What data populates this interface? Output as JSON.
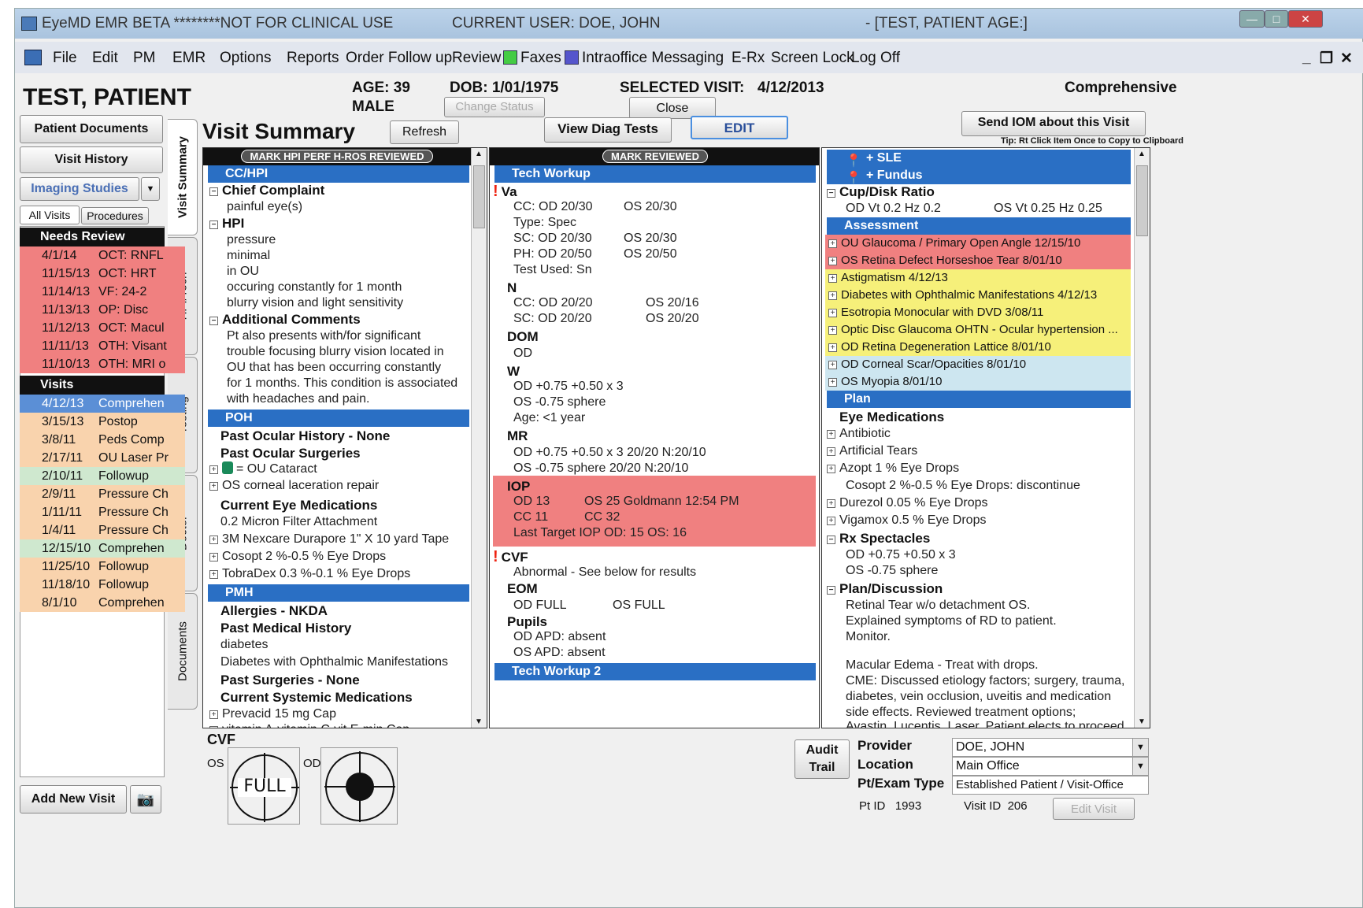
{
  "titlebar": {
    "app": "EyeMD EMR BETA ********NOT FOR CLINICAL USE",
    "user": "CURRENT USER: DOE, JOHN",
    "patient": "- [TEST, PATIENT  AGE:]"
  },
  "menu": [
    "File",
    "Edit",
    "PM",
    "EMR",
    "Options",
    "Reports",
    "Order Follow up",
    "Review",
    "Faxes",
    "Intraoffice Messaging",
    "E-Rx",
    "Screen Lock",
    "Log Off"
  ],
  "patient": {
    "name": "TEST, PATIENT",
    "age": "AGE: 39",
    "sex": "MALE",
    "dob": "DOB: 1/01/1975",
    "selected_visit_label": "SELECTED VISIT:",
    "selected_visit": "4/12/2013",
    "visit_type": "Comprehensive"
  },
  "buttons": {
    "change_status": "Change Status",
    "close": "Close",
    "patient_documents": "Patient Documents",
    "visit_history": "Visit History",
    "imaging_studies": "Imaging Studies",
    "all_visits": "All Visits",
    "procedures": "Procedures",
    "refresh": "Refresh",
    "view_diag_tests": "View Diag Tests",
    "edit": "EDIT",
    "send_iom": "Send IOM about this Visit",
    "tip": "Tip: Rt Click Item Once to Copy to Clipboard",
    "add_new_visit": "Add New Visit",
    "audit_trail": "Audit Trail",
    "edit_visit": "Edit Visit"
  },
  "page_title": "Visit Summary",
  "vertical_tabs": [
    "Visit Summary",
    "HPI/Tech",
    "Testing",
    "Doctor",
    "Documents"
  ],
  "needs_review": {
    "header": "Needs Review",
    "items": [
      {
        "date": "4/1/14",
        "desc": "OCT: RNFL"
      },
      {
        "date": "11/15/13",
        "desc": "OCT: HRT"
      },
      {
        "date": "11/14/13",
        "desc": "VF: 24-2"
      },
      {
        "date": "11/13/13",
        "desc": "OP: Disc"
      },
      {
        "date": "11/12/13",
        "desc": "OCT: Macul"
      },
      {
        "date": "11/11/13",
        "desc": "OTH: Visant"
      },
      {
        "date": "11/10/13",
        "desc": "OTH: MRI o"
      }
    ]
  },
  "visits": {
    "header": "Visits",
    "items": [
      {
        "date": "4/12/13",
        "desc": "Comprehen"
      },
      {
        "date": "3/15/13",
        "desc": "Postop"
      },
      {
        "date": "3/8/11",
        "desc": "Peds Comp"
      },
      {
        "date": "2/17/11",
        "desc": "OU Laser Pr"
      },
      {
        "date": "2/10/11",
        "desc": "Followup"
      },
      {
        "date": "2/9/11",
        "desc": "Pressure Ch"
      },
      {
        "date": "1/11/11",
        "desc": "Pressure Ch"
      },
      {
        "date": "1/4/11",
        "desc": "Pressure Ch"
      },
      {
        "date": "12/15/10",
        "desc": "Comprehen"
      },
      {
        "date": "11/25/10",
        "desc": "Followup"
      },
      {
        "date": "11/18/10",
        "desc": "Followup"
      },
      {
        "date": "8/1/10",
        "desc": "Comprehen"
      }
    ]
  },
  "col1": {
    "mark": "MARK HPI PERF H-ROS REVIEWED",
    "sections": {
      "cchpi": "CC/HPI",
      "poh": "POH",
      "pmh": "PMH"
    },
    "lines": [
      "Chief Complaint",
      "painful eye(s)",
      "HPI",
      "pressure",
      "minimal",
      "in OU",
      "occuring constantly for 1 month",
      "blurry vision and light sensitivity",
      "Additional Comments",
      "Pt also presents with/for significant",
      "trouble focusing blurry vision located in",
      "OU that has been occurring constantly",
      "for 1 months. This condition is associated",
      "with headaches and pain.",
      "Past Ocular History - None",
      "Past Ocular Surgeries",
      "= OU Cataract",
      "OS corneal laceration repair",
      "Current Eye Medications",
      "0.2 Micron Filter Attachment",
      "3M Nexcare Durapore 1\" X 10 yard Tape",
      "Cosopt 2 %-0.5 % Eye Drops",
      "TobraDex 0.3 %-0.1 % Eye Drops",
      "Allergies - NKDA",
      "Past Medical History",
      "diabetes",
      "Diabetes with Ophthalmic Manifestations",
      "Past Surgeries - None",
      "Current Systemic Medications",
      "Prevacid 15 mg Cap",
      "vitamin A-vitamin C-vit E-min Cap"
    ]
  },
  "col2": {
    "mark": "MARK REVIEWED",
    "sections": {
      "tech": "Tech Workup",
      "tech2": "Tech Workup 2"
    },
    "lines": [
      "Va",
      "CC:  OD 20/30",
      "OS 20/30",
      "Type: Spec",
      "SC:  OD 20/30",
      "OS 20/30",
      "PH:  OD 20/50",
      "OS 20/50",
      "Test Used: Sn",
      "N",
      "CC:  OD    20/20",
      "OS    20/16",
      "SC:  OD    20/20",
      "OS    20/20",
      "DOM",
      "OD",
      "W",
      "OD  +0.75 +0.50 x 3",
      "OS  -0.75 sphere",
      "Age: <1 year",
      "MR",
      "OD  +0.75 +0.50 x 3  20/20  N:20/10",
      "OS  -0.75 sphere  20/20  N:20/10",
      "IOP",
      "OD   13",
      "OS  25  Goldmann 12:54 PM",
      "CC   11",
      "CC  32",
      "Last Target IOP   OD: 15   OS: 16",
      "CVF",
      "Abnormal - See below for results",
      "EOM",
      "OD  FULL",
      "OS  FULL",
      "Pupils",
      "OD  APD: absent",
      "OS  APD: absent"
    ]
  },
  "col3": {
    "sections": {
      "sle": "+ SLE",
      "fundus": "+ Fundus",
      "assessment": "Assessment",
      "plan": "Plan"
    },
    "cup": {
      "title": "Cup/Disk Ratio",
      "od": "OD  Vt 0.2   Hz 0.2",
      "os": "OS  Vt 0.25   Hz 0.25"
    },
    "assessment": [
      "OU Glaucoma / Primary Open Angle  12/15/10",
      "OS Retina Defect Horseshoe Tear  8/01/10",
      "Astigmatism  4/12/13",
      "Diabetes with Ophthalmic Manifestations  4/12/13",
      "Esotropia Monocular with DVD  3/08/11",
      "Optic Disc Glaucoma OHTN - Ocular hypertension  ...",
      "OD Retina Degeneration Lattice  8/01/10",
      "OD Corneal Scar/Opacities  8/01/10",
      "OS Myopia  8/01/10"
    ],
    "plan": [
      "Eye Medications",
      "Antibiotic",
      "Artificial Tears",
      "Azopt 1 % Eye Drops",
      "Cosopt 2 %-0.5 % Eye Drops: discontinue",
      "Durezol 0.05 % Eye Drops",
      "Vigamox 0.5 % Eye Drops",
      "Rx Spectacles",
      "OD  +0.75 +0.50 x 3",
      "OS  -0.75 sphere",
      "Plan/Discussion",
      "Retinal Tear w/o detachment OS.",
      "Explained symptoms of RD to patient.",
      "Monitor.",
      "Macular Edema - Treat with drops.",
      "CME: Discussed etiology factors; surgery, trauma,",
      "diabetes, vein occlusion, uveitis and medication",
      "side effects.  Reviewed treatment options;",
      "Avastin, Lucentis, Laser.  Patient elects to proceed"
    ]
  },
  "cvf": {
    "title": "CVF",
    "os": "OS",
    "od": "OD",
    "full": "FULL"
  },
  "footer": {
    "provider_label": "Provider",
    "provider": "DOE, JOHN",
    "location_label": "Location",
    "location": "Main Office",
    "exam_label": "Pt/Exam Type",
    "exam": "Established Patient / Visit-Office",
    "ptid": "Pt ID   1993",
    "visitid": "Visit ID  206"
  },
  "colors": {
    "section": "#2a6fc4",
    "alert": "#f08080",
    "warn": "#f6f07a",
    "info": "#cde6f0",
    "visit_orange": "#f9d3ad",
    "visit_green": "#cfe8cf"
  }
}
